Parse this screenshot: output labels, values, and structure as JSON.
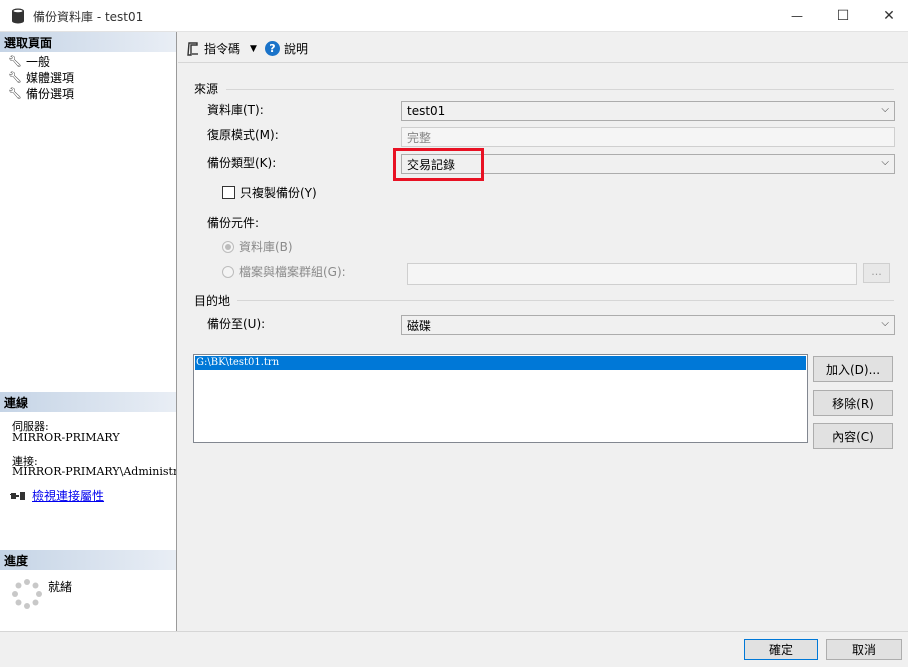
{
  "window": {
    "title": "備份資料庫 - test01",
    "minimize_glyph": "—",
    "maximize_glyph": "☐",
    "close_glyph": "✕"
  },
  "left": {
    "select_page_header": "選取頁面",
    "nav_items": [
      {
        "label": "一般",
        "icon": "wrench-icon"
      },
      {
        "label": "媒體選項",
        "icon": "wrench-icon"
      },
      {
        "label": "備份選項",
        "icon": "wrench-icon"
      }
    ],
    "connection_header": "連線",
    "server_label": "伺服器:",
    "server_value": "MIRROR-PRIMARY",
    "connection_label": "連接:",
    "connection_value": "MIRROR-PRIMARY\\Administrato",
    "view_link": "檢視連接屬性",
    "progress_header": "進度",
    "progress_status": "就緒"
  },
  "toolbar": {
    "script_label": "指令碼",
    "help_label": "說明"
  },
  "source": {
    "group_label": "來源",
    "database_label": "資料庫(T):",
    "database_value": "test01",
    "recovery_label": "復原模式(M):",
    "recovery_value": "完整",
    "backup_type_label": "備份類型(K):",
    "backup_type_value": "交易記錄",
    "copy_only_label": "只複製備份(Y)",
    "component_label": "備份元件:",
    "component_database_label": "資料庫(B)",
    "component_files_label": "檔案與檔案群組(G):",
    "browse_label": "..."
  },
  "destination": {
    "group_label": "目的地",
    "backup_to_label": "備份至(U):",
    "backup_to_value": "磁碟",
    "paths": [
      "G:\\BK\\test01.trn"
    ],
    "add_button": "加入(D)...",
    "remove_button": "移除(R)",
    "contents_button": "內容(C)"
  },
  "footer": {
    "ok_button": "確定",
    "cancel_button": "取消"
  },
  "colors": {
    "selection": "#0078d7",
    "highlight_box": "#e81123",
    "help_icon": "#1a73c9",
    "link": "#0000ee"
  }
}
